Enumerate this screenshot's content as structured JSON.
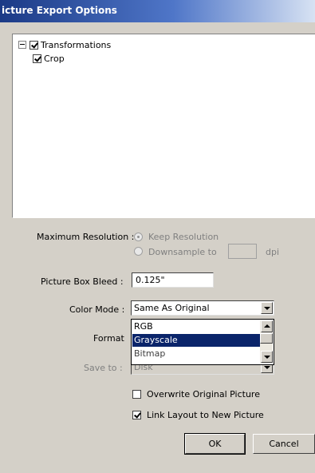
{
  "window": {
    "title": "icture Export Options"
  },
  "tree": {
    "items": [
      {
        "label": "Transformations",
        "checked": true,
        "expander": "minus"
      },
      {
        "label": "Crop",
        "checked": true
      }
    ]
  },
  "resolution": {
    "label": "Maximum Resolution :",
    "option_keep": "Keep Resolution",
    "option_downsample": "Downsample to",
    "downsample_value": "",
    "unit": "dpi"
  },
  "bleed": {
    "label": "Picture Box Bleed :",
    "value": "0.125\""
  },
  "color_mode": {
    "label": "Color Mode :",
    "selected": "Same As Original",
    "options": [
      "RGB",
      "Grayscale",
      "Bitmap"
    ],
    "highlighted": "Grayscale"
  },
  "format": {
    "label": "Format"
  },
  "save_to": {
    "label": "Save to :",
    "value": "Disk"
  },
  "checkboxes": {
    "overwrite": {
      "label": "Overwrite Original Picture",
      "checked": false
    },
    "link_layout": {
      "label": "Link Layout to New Picture",
      "checked": true
    }
  },
  "buttons": {
    "ok": "OK",
    "cancel": "Cancel"
  },
  "colors": {
    "selection": "#0a246a",
    "dialog_bg": "#d4d0c8",
    "title_start": "#1b3a86"
  }
}
